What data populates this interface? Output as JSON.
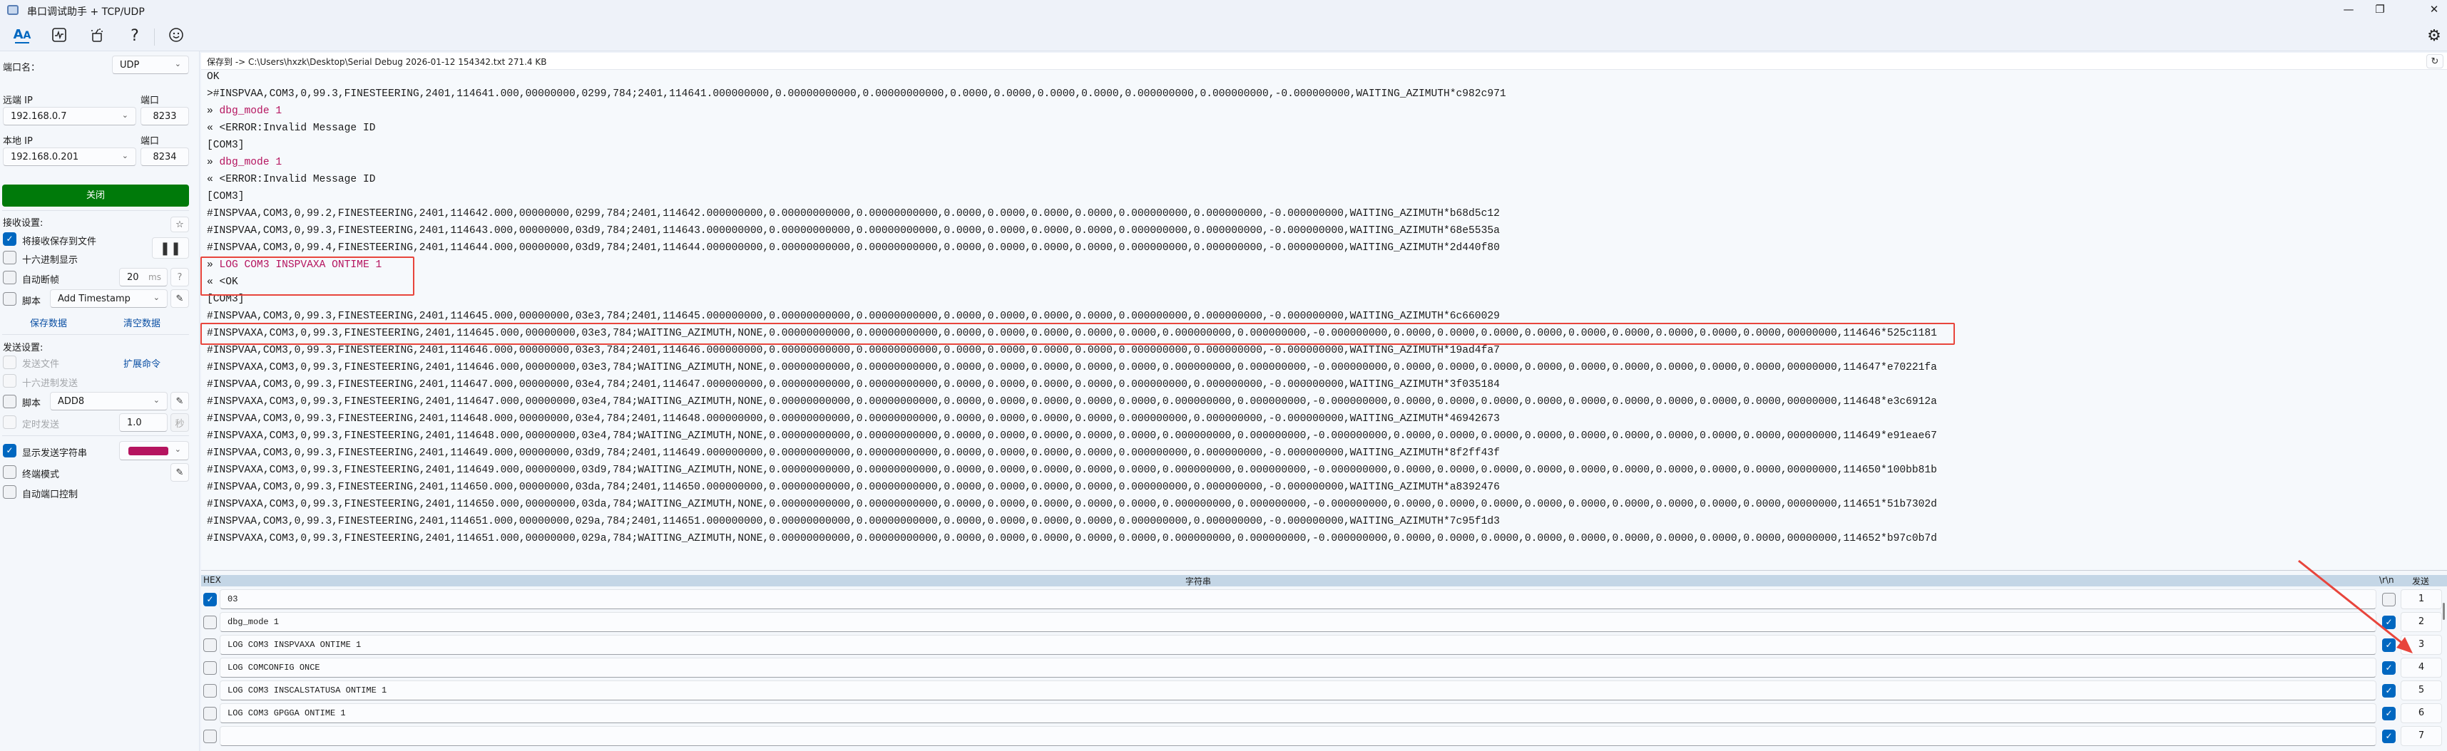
{
  "window": {
    "title": "串口调试助手 + TCP/UDP",
    "minimize": "—",
    "restore": "❐",
    "close": "✕"
  },
  "toolbar": {
    "icons": [
      "font-icon",
      "waveform-icon",
      "tools-icon",
      "help-icon",
      "smiley-icon"
    ],
    "help_glyph": "?",
    "settings_glyph": "⚙"
  },
  "sidebar": {
    "port_name_label": "端口名：",
    "port_type": "UDP",
    "remote_ip_label": "远端 IP",
    "remote_ip": "192.168.0.7",
    "remote_port_label": "端口",
    "remote_port": "8233",
    "local_ip_label": "本地 IP",
    "local_ip": "192.168.0.201",
    "local_port_label": "端口",
    "local_port": "8234",
    "close_button": "关闭",
    "recv_settings_label": "接收设置:",
    "save_to_file": "将接收保存到文件",
    "hex_display": "十六进制显示",
    "auto_frame": "自动断帧",
    "frame_ms": "20",
    "frame_unit": "ms",
    "help_btn": "?",
    "recv_script_label": "脚本",
    "recv_script": "Add Timestamp",
    "save_data": "保存数据",
    "clear_data": "清空数据",
    "send_settings_label": "发送设置:",
    "send_file": "发送文件",
    "ext_cmd": "扩展命令",
    "hex_send": "十六进制发送",
    "send_script_label": "脚本",
    "send_script": "ADD8",
    "timed_send": "定时发送",
    "timed_interval": "1.0",
    "timed_unit": "秒",
    "show_send_string": "显示发送字符串",
    "send_color": "#b5145f",
    "terminal_mode": "终端模式",
    "auto_port_ctrl": "自动端口控制"
  },
  "savebar": {
    "text": "保存到 -> C:\\Users\\hxzk\\Desktop\\Serial Debug 2026-01-12 154342.txt  271.4 KB"
  },
  "log": [
    {
      "p": "",
      "t": "OK",
      "c": "n"
    },
    {
      "p": "",
      "t": ">#INSPVAA,COM3,0,99.3,FINESTEERING,2401,114641.000,00000000,0299,784;2401,114641.000000000,0.00000000000,0.00000000000,0.0000,0.0000,0.0000,0.0000,0.000000000,0.000000000,-0.000000000,WAITING_AZIMUTH*c982c971",
      "c": "n"
    },
    {
      "p": "» ",
      "t": "dbg_mode 1",
      "c": "m"
    },
    {
      "p": "« ",
      "t": "<ERROR:Invalid Message ID",
      "c": "n"
    },
    {
      "p": "",
      "t": "[COM3]",
      "c": "n"
    },
    {
      "p": "» ",
      "t": "dbg_mode 1",
      "c": "m"
    },
    {
      "p": "« ",
      "t": "<ERROR:Invalid Message ID",
      "c": "n"
    },
    {
      "p": "",
      "t": "[COM3]",
      "c": "n"
    },
    {
      "p": "",
      "t": "#INSPVAA,COM3,0,99.2,FINESTEERING,2401,114642.000,00000000,0299,784;2401,114642.000000000,0.00000000000,0.00000000000,0.0000,0.0000,0.0000,0.0000,0.000000000,0.000000000,-0.000000000,WAITING_AZIMUTH*b68d5c12",
      "c": "n"
    },
    {
      "p": "",
      "t": "#INSPVAA,COM3,0,99.3,FINESTEERING,2401,114643.000,00000000,03d9,784;2401,114643.000000000,0.00000000000,0.00000000000,0.0000,0.0000,0.0000,0.0000,0.000000000,0.000000000,-0.000000000,WAITING_AZIMUTH*68e5535a",
      "c": "n"
    },
    {
      "p": "",
      "t": "#INSPVAA,COM3,0,99.4,FINESTEERING,2401,114644.000,00000000,03d9,784;2401,114644.000000000,0.00000000000,0.00000000000,0.0000,0.0000,0.0000,0.0000,0.000000000,0.000000000,-0.000000000,WAITING_AZIMUTH*2d440f80",
      "c": "n"
    },
    {
      "p": "» ",
      "t": "LOG COM3 INSPVAXA ONTIME 1",
      "c": "m"
    },
    {
      "p": "« ",
      "t": "<OK",
      "c": "n"
    },
    {
      "p": "",
      "t": "[COM3]",
      "c": "n"
    },
    {
      "p": "",
      "t": "#INSPVAA,COM3,0,99.3,FINESTEERING,2401,114645.000,00000000,03e3,784;2401,114645.000000000,0.00000000000,0.00000000000,0.0000,0.0000,0.0000,0.0000,0.000000000,0.000000000,-0.000000000,WAITING_AZIMUTH*6c660029",
      "c": "n"
    },
    {
      "p": "",
      "t": "#INSPVAXA,COM3,0,99.3,FINESTEERING,2401,114645.000,00000000,03e3,784;WAITING_AZIMUTH,NONE,0.00000000000,0.00000000000,0.0000,0.0000,0.0000,0.0000,0.0000,0.000000000,0.000000000,-0.000000000,0.0000,0.0000,0.0000,0.0000,0.0000,0.0000,0.0000,0.0000,0.0000,00000000,114646*525c1181",
      "c": "n"
    },
    {
      "p": "",
      "t": "#INSPVAA,COM3,0,99.3,FINESTEERING,2401,114646.000,00000000,03e3,784;2401,114646.000000000,0.00000000000,0.00000000000,0.0000,0.0000,0.0000,0.0000,0.000000000,0.000000000,-0.000000000,WAITING_AZIMUTH*19ad4fa7",
      "c": "n"
    },
    {
      "p": "",
      "t": "#INSPVAXA,COM3,0,99.3,FINESTEERING,2401,114646.000,00000000,03e3,784;WAITING_AZIMUTH,NONE,0.00000000000,0.00000000000,0.0000,0.0000,0.0000,0.0000,0.0000,0.000000000,0.000000000,-0.000000000,0.0000,0.0000,0.0000,0.0000,0.0000,0.0000,0.0000,0.0000,0.0000,00000000,114647*e70221fa",
      "c": "n"
    },
    {
      "p": "",
      "t": "#INSPVAA,COM3,0,99.3,FINESTEERING,2401,114647.000,00000000,03e4,784;2401,114647.000000000,0.00000000000,0.00000000000,0.0000,0.0000,0.0000,0.0000,0.000000000,0.000000000,-0.000000000,WAITING_AZIMUTH*3f035184",
      "c": "n"
    },
    {
      "p": "",
      "t": "#INSPVAXA,COM3,0,99.3,FINESTEERING,2401,114647.000,00000000,03e4,784;WAITING_AZIMUTH,NONE,0.00000000000,0.00000000000,0.0000,0.0000,0.0000,0.0000,0.0000,0.000000000,0.000000000,-0.000000000,0.0000,0.0000,0.0000,0.0000,0.0000,0.0000,0.0000,0.0000,0.0000,00000000,114648*e3c6912a",
      "c": "n"
    },
    {
      "p": "",
      "t": "#INSPVAA,COM3,0,99.3,FINESTEERING,2401,114648.000,00000000,03e4,784;2401,114648.000000000,0.00000000000,0.00000000000,0.0000,0.0000,0.0000,0.0000,0.000000000,0.000000000,-0.000000000,WAITING_AZIMUTH*46942673",
      "c": "n"
    },
    {
      "p": "",
      "t": "#INSPVAXA,COM3,0,99.3,FINESTEERING,2401,114648.000,00000000,03e4,784;WAITING_AZIMUTH,NONE,0.00000000000,0.00000000000,0.0000,0.0000,0.0000,0.0000,0.0000,0.000000000,0.000000000,-0.000000000,0.0000,0.0000,0.0000,0.0000,0.0000,0.0000,0.0000,0.0000,0.0000,00000000,114649*e91eae67",
      "c": "n"
    },
    {
      "p": "",
      "t": "#INSPVAA,COM3,0,99.3,FINESTEERING,2401,114649.000,00000000,03d9,784;2401,114649.000000000,0.00000000000,0.00000000000,0.0000,0.0000,0.0000,0.0000,0.000000000,0.000000000,-0.000000000,WAITING_AZIMUTH*8f2ff43f",
      "c": "n"
    },
    {
      "p": "",
      "t": "#INSPVAXA,COM3,0,99.3,FINESTEERING,2401,114649.000,00000000,03d9,784;WAITING_AZIMUTH,NONE,0.00000000000,0.00000000000,0.0000,0.0000,0.0000,0.0000,0.0000,0.000000000,0.000000000,-0.000000000,0.0000,0.0000,0.0000,0.0000,0.0000,0.0000,0.0000,0.0000,0.0000,00000000,114650*100bb81b",
      "c": "n"
    },
    {
      "p": "",
      "t": "#INSPVAA,COM3,0,99.3,FINESTEERING,2401,114650.000,00000000,03da,784;2401,114650.000000000,0.00000000000,0.00000000000,0.0000,0.0000,0.0000,0.0000,0.000000000,0.000000000,-0.000000000,WAITING_AZIMUTH*a8392476",
      "c": "n"
    },
    {
      "p": "",
      "t": "#INSPVAXA,COM3,0,99.3,FINESTEERING,2401,114650.000,00000000,03da,784;WAITING_AZIMUTH,NONE,0.00000000000,0.00000000000,0.0000,0.0000,0.0000,0.0000,0.0000,0.000000000,0.000000000,-0.000000000,0.0000,0.0000,0.0000,0.0000,0.0000,0.0000,0.0000,0.0000,0.0000,00000000,114651*51b7302d",
      "c": "n"
    },
    {
      "p": "",
      "t": "#INSPVAA,COM3,0,99.3,FINESTEERING,2401,114651.000,00000000,029a,784;2401,114651.000000000,0.00000000000,0.00000000000,0.0000,0.0000,0.0000,0.0000,0.000000000,0.000000000,-0.000000000,WAITING_AZIMUTH*7c95f1d3",
      "c": "n"
    },
    {
      "p": "",
      "t": "#INSPVAXA,COM3,0,99.3,FINESTEERING,2401,114651.000,00000000,029a,784;WAITING_AZIMUTH,NONE,0.00000000000,0.00000000000,0.0000,0.0000,0.0000,0.0000,0.0000,0.000000000,0.000000000,-0.000000000,0.0000,0.0000,0.0000,0.0000,0.0000,0.0000,0.0000,0.0000,0.0000,00000000,114652*b97c0b7d",
      "c": "n"
    }
  ],
  "send_panel": {
    "hex_header": "HEX",
    "string_header": "字符串",
    "crlf_header": "\\r\\n",
    "send_header": "发送",
    "rows": [
      {
        "hex": true,
        "text": "03",
        "crlf": false,
        "btn": "1"
      },
      {
        "hex": false,
        "text": "dbg_mode 1",
        "crlf": true,
        "btn": "2"
      },
      {
        "hex": false,
        "text": "LOG COM3 INSPVAXA ONTIME 1",
        "crlf": true,
        "btn": "3"
      },
      {
        "hex": false,
        "text": "LOG COMCONFIG ONCE",
        "crlf": true,
        "btn": "4"
      },
      {
        "hex": false,
        "text": "LOG COM3 INSCALSTATUSA ONTIME 1",
        "crlf": true,
        "btn": "5"
      },
      {
        "hex": false,
        "text": "LOG COM3 GPGGA ONTIME 1",
        "crlf": true,
        "btn": "6"
      },
      {
        "hex": false,
        "text": "",
        "crlf": true,
        "btn": "7"
      }
    ]
  },
  "colors": {
    "accent": "#0067c0",
    "close_button": "#007a0a",
    "annotation": "#e8453c",
    "sent_text": "#b5145f"
  }
}
